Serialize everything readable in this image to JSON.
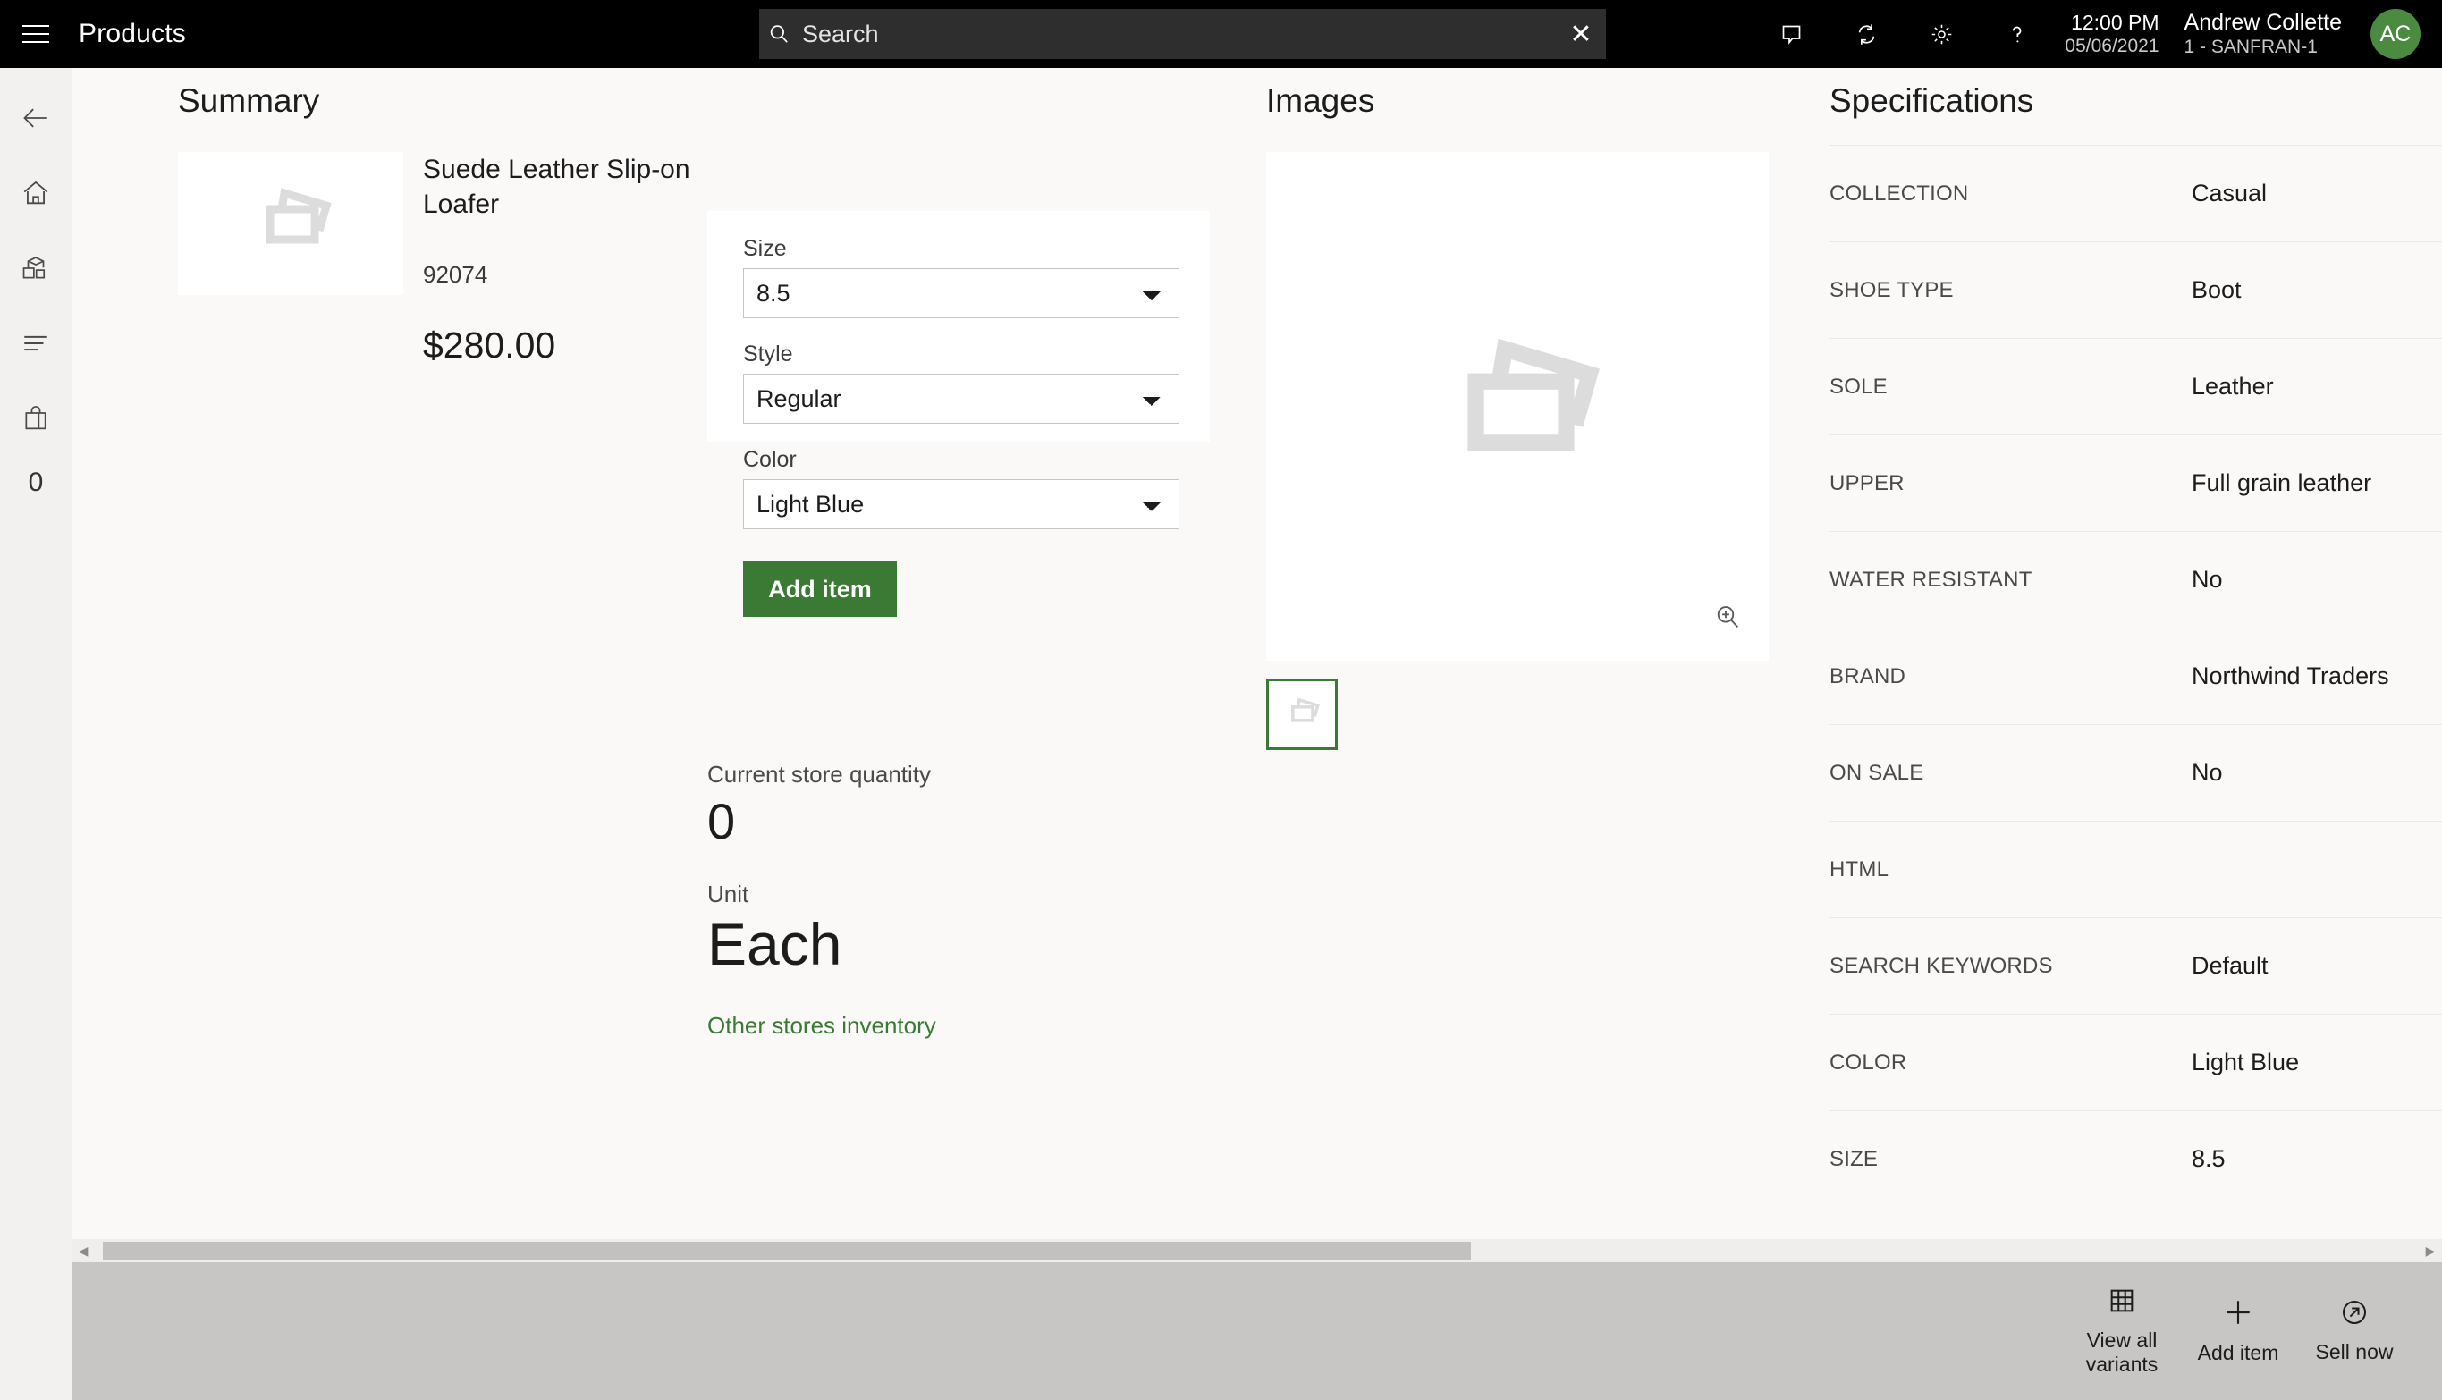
{
  "header": {
    "menu_icon": "hamburger-icon",
    "title": "Products",
    "search": {
      "icon": "search-icon",
      "placeholder": "Search",
      "value": "",
      "clear_icon": "close-icon"
    },
    "icons": [
      "feedback-icon",
      "sync-icon",
      "gear-icon",
      "help-icon"
    ],
    "time": "12:00 PM",
    "date": "05/06/2021",
    "user_name": "Andrew Collette",
    "store": "1 - SANFRAN-1",
    "avatar_initials": "AC",
    "avatar_color": "#4a8b3f"
  },
  "rail": {
    "items": [
      {
        "icon": "back-arrow-icon",
        "name": "back"
      },
      {
        "icon": "home-icon",
        "name": "home"
      },
      {
        "icon": "products-icon",
        "name": "products"
      },
      {
        "icon": "list-icon",
        "name": "transactions"
      },
      {
        "icon": "shopping-bag-icon",
        "name": "cart"
      }
    ],
    "cart_count": "0"
  },
  "summary": {
    "title": "Summary",
    "product_name": "Suede Leather Slip-on Loafer",
    "product_id": "92074",
    "price": "$280.00",
    "thumb_icon": "image-placeholder-icon"
  },
  "variant_form": {
    "fields": [
      {
        "label": "Size",
        "value": "8.5",
        "name": "size"
      },
      {
        "label": "Style",
        "value": "Regular",
        "name": "style"
      },
      {
        "label": "Color",
        "value": "Light Blue",
        "name": "color"
      }
    ],
    "add_button": "Add item",
    "add_button_color": "#3a7a34"
  },
  "inventory": {
    "quantity_label": "Current store quantity",
    "quantity_value": "0",
    "unit_label": "Unit",
    "unit_value": "Each",
    "other_stores_link": "Other stores inventory",
    "link_color": "#3a7a34"
  },
  "images": {
    "title": "Images",
    "main_icon": "image-placeholder-icon",
    "zoom_icon": "zoom-in-icon",
    "thumbnails": [
      {
        "icon": "image-placeholder-icon",
        "selected": true
      }
    ],
    "selected_border_color": "#3a7a34"
  },
  "specifications": {
    "title": "Specifications",
    "rows": [
      {
        "key": "COLLECTION",
        "value": "Casual"
      },
      {
        "key": "SHOE TYPE",
        "value": "Boot"
      },
      {
        "key": "SOLE",
        "value": "Leather"
      },
      {
        "key": "UPPER",
        "value": "Full grain leather"
      },
      {
        "key": "WATER RESISTANT",
        "value": "No"
      },
      {
        "key": "BRAND",
        "value": "Northwind Traders"
      },
      {
        "key": "ON SALE",
        "value": "No"
      },
      {
        "key": "HTML",
        "value": ""
      },
      {
        "key": "SEARCH KEYWORDS",
        "value": "Default"
      },
      {
        "key": "COLOR",
        "value": "Light Blue"
      },
      {
        "key": "SIZE",
        "value": "8.5"
      }
    ]
  },
  "scrollbar": {
    "left_arrow": "chevron-left-icon",
    "right_arrow": "chevron-right-icon"
  },
  "command_bar": {
    "buttons": [
      {
        "icon": "grid-icon",
        "label": "View all variants",
        "name": "view-all-variants"
      },
      {
        "icon": "plus-icon",
        "label": "Add item",
        "name": "add-item"
      },
      {
        "icon": "arrow-circle-icon",
        "label": "Sell now",
        "name": "sell-now"
      }
    ]
  }
}
